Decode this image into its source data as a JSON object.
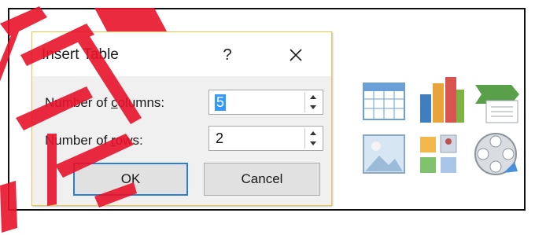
{
  "dialog": {
    "title": "Insert Table",
    "help_label": "?",
    "columns_label_prefix": "Number of ",
    "columns_label_key": "c",
    "columns_label_rest": "olumns:",
    "columns_value": "5",
    "rows_label_prefix": "Number of ",
    "rows_label_key": "r",
    "rows_label_rest": "ows:",
    "rows_value": "2",
    "ok_label": "OK",
    "cancel_label": "Cancel"
  },
  "icons": [
    "table-icon",
    "chart-icon",
    "smartart-icon",
    "picture-icon",
    "clip-art-icon",
    "media-icon"
  ],
  "colors": {
    "watermark": "#e8132b",
    "focus_border": "#2b7fd8",
    "selection": "#3399ff"
  }
}
